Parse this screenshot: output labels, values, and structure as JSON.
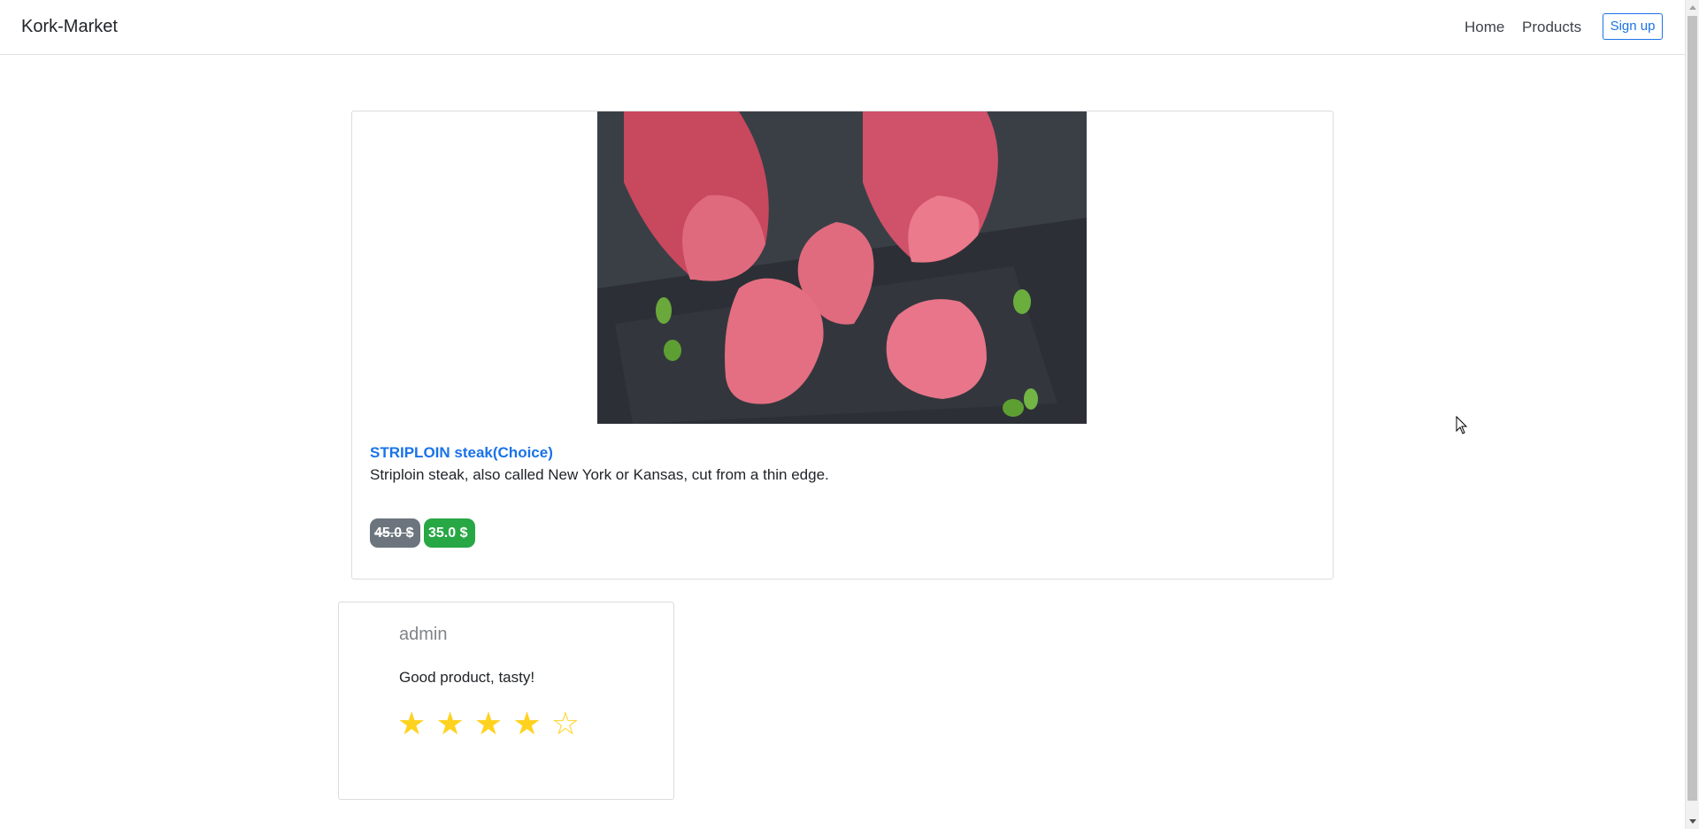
{
  "navbar": {
    "brand": "Kork-Market",
    "links": [
      "Home",
      "Products"
    ],
    "signup_label": "Sign up"
  },
  "product": {
    "title": "STRIPLOIN steak(Choice)",
    "description": "Striploin steak, also called New York or Kansas, cut from a thin edge.",
    "old_price": "45.0 $",
    "new_price": "35.0 $",
    "image_icon": "raw-tuna-steak-image"
  },
  "review": {
    "author": "admin",
    "text": "Good product, tasty!",
    "rating": 4,
    "max_rating": 5,
    "stars": [
      "★",
      "★",
      "★",
      "★",
      "☆"
    ]
  },
  "colors": {
    "link_blue": "#1a73e8",
    "old_price_badge": "#6c757d",
    "new_price_badge": "#28a745",
    "star": "#ffd21f"
  }
}
